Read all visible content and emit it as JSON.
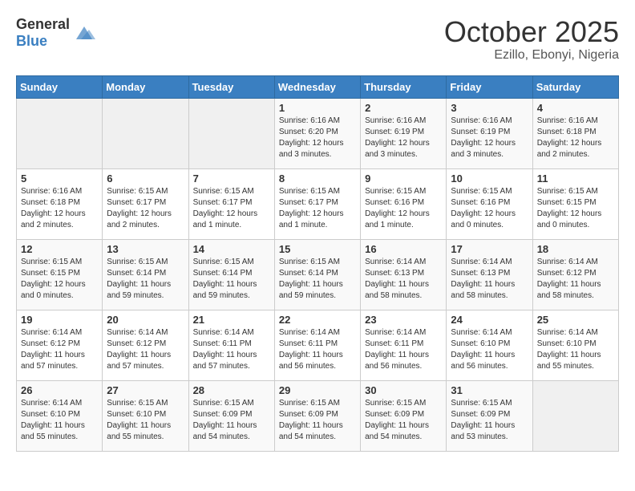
{
  "header": {
    "logo_general": "General",
    "logo_blue": "Blue",
    "month": "October 2025",
    "location": "Ezillo, Ebonyi, Nigeria"
  },
  "weekdays": [
    "Sunday",
    "Monday",
    "Tuesday",
    "Wednesday",
    "Thursday",
    "Friday",
    "Saturday"
  ],
  "weeks": [
    [
      {
        "day": "",
        "info": ""
      },
      {
        "day": "",
        "info": ""
      },
      {
        "day": "",
        "info": ""
      },
      {
        "day": "1",
        "info": "Sunrise: 6:16 AM\nSunset: 6:20 PM\nDaylight: 12 hours\nand 3 minutes."
      },
      {
        "day": "2",
        "info": "Sunrise: 6:16 AM\nSunset: 6:19 PM\nDaylight: 12 hours\nand 3 minutes."
      },
      {
        "day": "3",
        "info": "Sunrise: 6:16 AM\nSunset: 6:19 PM\nDaylight: 12 hours\nand 3 minutes."
      },
      {
        "day": "4",
        "info": "Sunrise: 6:16 AM\nSunset: 6:18 PM\nDaylight: 12 hours\nand 2 minutes."
      }
    ],
    [
      {
        "day": "5",
        "info": "Sunrise: 6:16 AM\nSunset: 6:18 PM\nDaylight: 12 hours\nand 2 minutes."
      },
      {
        "day": "6",
        "info": "Sunrise: 6:15 AM\nSunset: 6:17 PM\nDaylight: 12 hours\nand 2 minutes."
      },
      {
        "day": "7",
        "info": "Sunrise: 6:15 AM\nSunset: 6:17 PM\nDaylight: 12 hours\nand 1 minute."
      },
      {
        "day": "8",
        "info": "Sunrise: 6:15 AM\nSunset: 6:17 PM\nDaylight: 12 hours\nand 1 minute."
      },
      {
        "day": "9",
        "info": "Sunrise: 6:15 AM\nSunset: 6:16 PM\nDaylight: 12 hours\nand 1 minute."
      },
      {
        "day": "10",
        "info": "Sunrise: 6:15 AM\nSunset: 6:16 PM\nDaylight: 12 hours\nand 0 minutes."
      },
      {
        "day": "11",
        "info": "Sunrise: 6:15 AM\nSunset: 6:15 PM\nDaylight: 12 hours\nand 0 minutes."
      }
    ],
    [
      {
        "day": "12",
        "info": "Sunrise: 6:15 AM\nSunset: 6:15 PM\nDaylight: 12 hours\nand 0 minutes."
      },
      {
        "day": "13",
        "info": "Sunrise: 6:15 AM\nSunset: 6:14 PM\nDaylight: 11 hours\nand 59 minutes."
      },
      {
        "day": "14",
        "info": "Sunrise: 6:15 AM\nSunset: 6:14 PM\nDaylight: 11 hours\nand 59 minutes."
      },
      {
        "day": "15",
        "info": "Sunrise: 6:15 AM\nSunset: 6:14 PM\nDaylight: 11 hours\nand 59 minutes."
      },
      {
        "day": "16",
        "info": "Sunrise: 6:14 AM\nSunset: 6:13 PM\nDaylight: 11 hours\nand 58 minutes."
      },
      {
        "day": "17",
        "info": "Sunrise: 6:14 AM\nSunset: 6:13 PM\nDaylight: 11 hours\nand 58 minutes."
      },
      {
        "day": "18",
        "info": "Sunrise: 6:14 AM\nSunset: 6:12 PM\nDaylight: 11 hours\nand 58 minutes."
      }
    ],
    [
      {
        "day": "19",
        "info": "Sunrise: 6:14 AM\nSunset: 6:12 PM\nDaylight: 11 hours\nand 57 minutes."
      },
      {
        "day": "20",
        "info": "Sunrise: 6:14 AM\nSunset: 6:12 PM\nDaylight: 11 hours\nand 57 minutes."
      },
      {
        "day": "21",
        "info": "Sunrise: 6:14 AM\nSunset: 6:11 PM\nDaylight: 11 hours\nand 57 minutes."
      },
      {
        "day": "22",
        "info": "Sunrise: 6:14 AM\nSunset: 6:11 PM\nDaylight: 11 hours\nand 56 minutes."
      },
      {
        "day": "23",
        "info": "Sunrise: 6:14 AM\nSunset: 6:11 PM\nDaylight: 11 hours\nand 56 minutes."
      },
      {
        "day": "24",
        "info": "Sunrise: 6:14 AM\nSunset: 6:10 PM\nDaylight: 11 hours\nand 56 minutes."
      },
      {
        "day": "25",
        "info": "Sunrise: 6:14 AM\nSunset: 6:10 PM\nDaylight: 11 hours\nand 55 minutes."
      }
    ],
    [
      {
        "day": "26",
        "info": "Sunrise: 6:14 AM\nSunset: 6:10 PM\nDaylight: 11 hours\nand 55 minutes."
      },
      {
        "day": "27",
        "info": "Sunrise: 6:15 AM\nSunset: 6:10 PM\nDaylight: 11 hours\nand 55 minutes."
      },
      {
        "day": "28",
        "info": "Sunrise: 6:15 AM\nSunset: 6:09 PM\nDaylight: 11 hours\nand 54 minutes."
      },
      {
        "day": "29",
        "info": "Sunrise: 6:15 AM\nSunset: 6:09 PM\nDaylight: 11 hours\nand 54 minutes."
      },
      {
        "day": "30",
        "info": "Sunrise: 6:15 AM\nSunset: 6:09 PM\nDaylight: 11 hours\nand 54 minutes."
      },
      {
        "day": "31",
        "info": "Sunrise: 6:15 AM\nSunset: 6:09 PM\nDaylight: 11 hours\nand 53 minutes."
      },
      {
        "day": "",
        "info": ""
      }
    ]
  ]
}
